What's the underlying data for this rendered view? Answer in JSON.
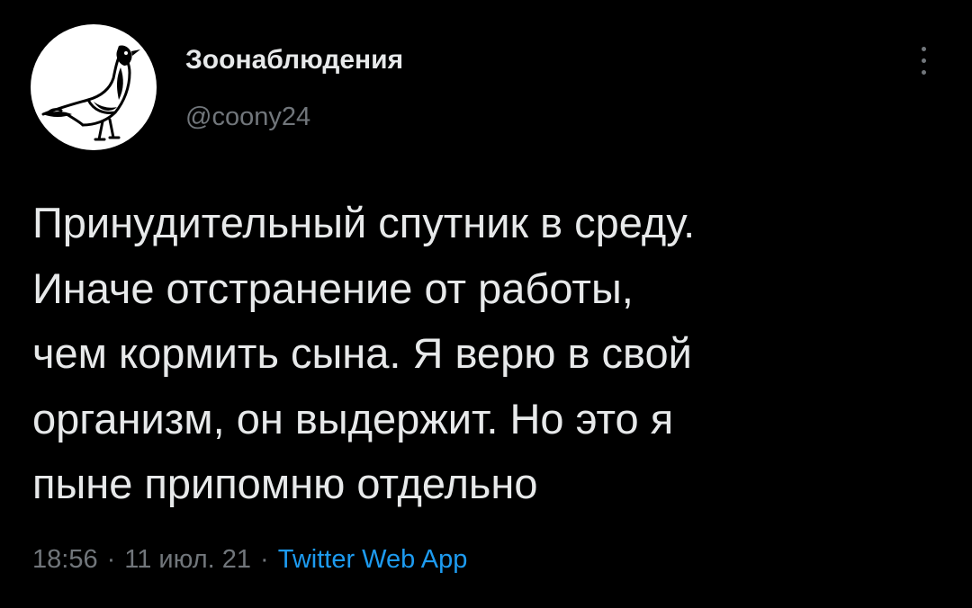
{
  "tweet": {
    "author": {
      "display_name": "Зоонаблюдения",
      "handle": "@coony24",
      "avatar_icon": "pigeon-avatar-icon"
    },
    "menu_icon": "more-vertical-icon",
    "text_lines": [
      "Принудительный спутник в среду.",
      "Иначе отстранение от работы,",
      "чем кормить сына. Я верю в свой",
      "организм, он выдержит. Но это я",
      "пыне припомню отдельно"
    ],
    "meta": {
      "time": "18:56",
      "date": "11 июл. 21",
      "separator": "·",
      "source": "Twitter Web App"
    }
  },
  "colors": {
    "background": "#000000",
    "primary_text": "#e7e9ea",
    "secondary_text": "#71767b",
    "link": "#1d9bf0"
  }
}
